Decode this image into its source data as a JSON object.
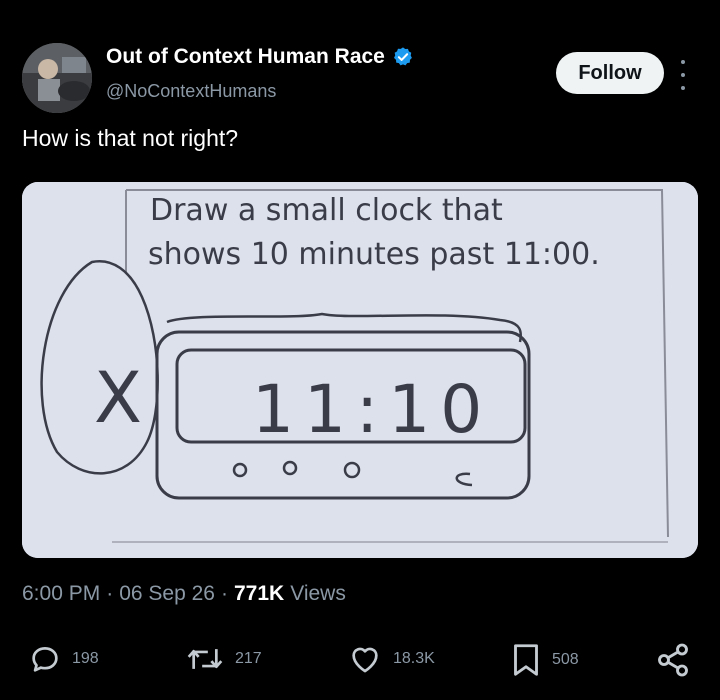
{
  "author": {
    "name": "Out of Context Human Race",
    "handle": "@NoContextHumans",
    "verified": true
  },
  "follow_label": "Follow",
  "tweet_text": "How is that not right?",
  "media": {
    "prompt_line1": "Draw a small clock that",
    "prompt_line2": "shows 10 minutes past 11:00.",
    "clock_display": "11:10",
    "mark": "X"
  },
  "meta": {
    "time": "6:00 PM",
    "sep": "·",
    "date": "06 Sep 26",
    "views_count": "771K",
    "views_label": "Views"
  },
  "actions": {
    "replies": "198",
    "reposts": "217",
    "likes": "18.3K",
    "bookmarks": "508"
  },
  "colors": {
    "background": "#000000",
    "text": "#e7e9ea",
    "secondary": "#8b98a5",
    "verified": "#1d9bf0",
    "button_bg": "#eff3f4"
  },
  "icons": [
    "verified-badge-icon",
    "more-icon",
    "reply-icon",
    "repost-icon",
    "like-icon",
    "bookmark-icon",
    "share-icon"
  ]
}
